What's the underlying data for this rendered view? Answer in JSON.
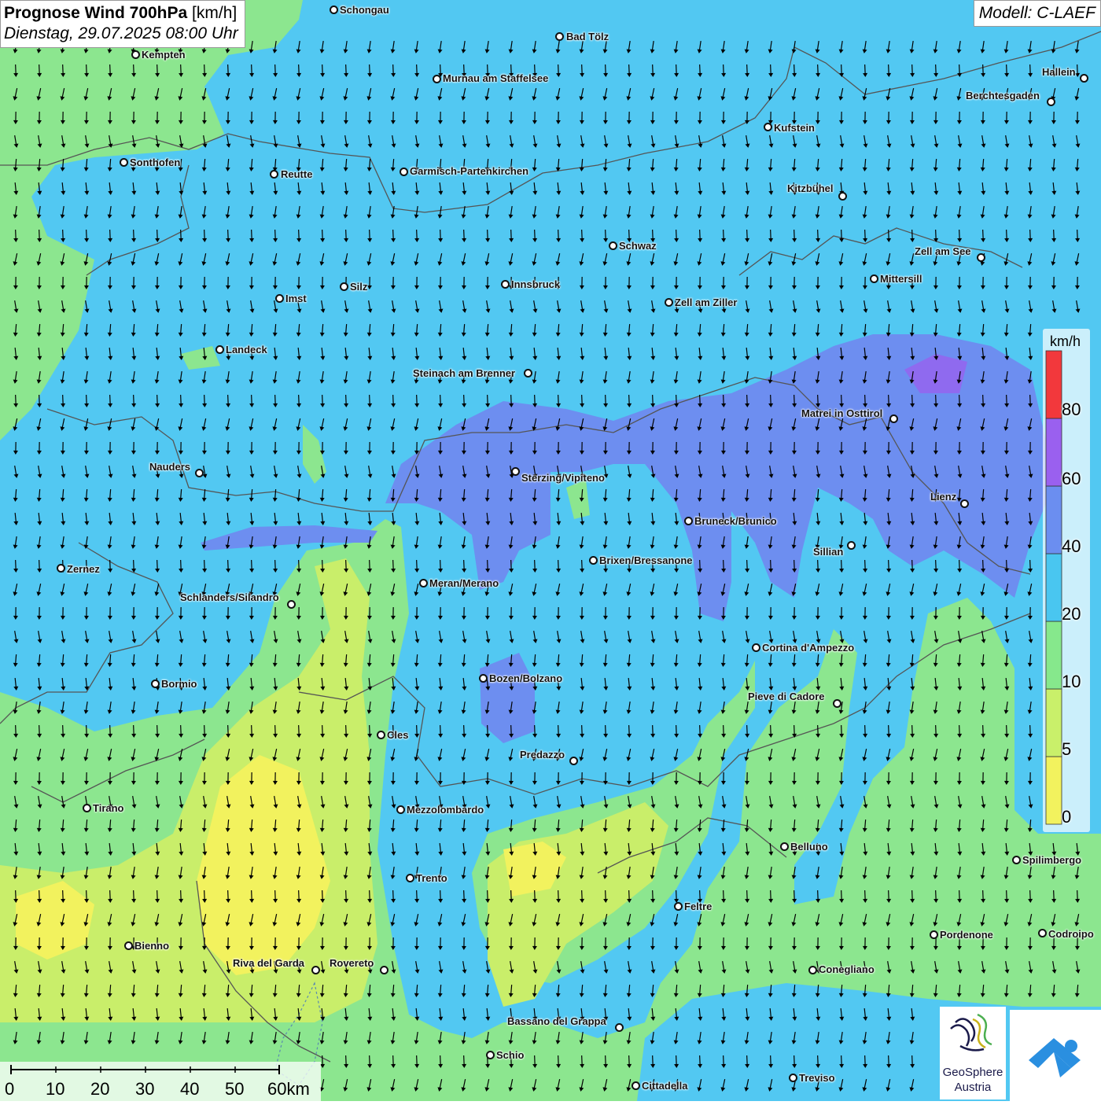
{
  "header": {
    "title_main": "Prognose Wind 700hPa",
    "title_unit": "[km/h]",
    "subtitle": "Dienstag, 29.07.2025 08:00 Uhr",
    "model": "Modell: C-LAEF"
  },
  "legend": {
    "unit": "km/h",
    "ticks": [
      "0",
      "5",
      "10",
      "20",
      "40",
      "60",
      "80"
    ],
    "colors": [
      "#f2f25e",
      "#c9f06a",
      "#86e88c",
      "#49c6f0",
      "#6b8ef0",
      "#9a60ef",
      "#f2383c"
    ]
  },
  "cities": [
    {
      "name": "Schongau"
    },
    {
      "name": "Bad Tölz"
    },
    {
      "name": "Kempten"
    },
    {
      "name": "Murnau am Staffelsee"
    },
    {
      "name": "Hallein"
    },
    {
      "name": "Berchtesgaden"
    },
    {
      "name": "Kufstein"
    },
    {
      "name": "Sonthofen"
    },
    {
      "name": "Reutte"
    },
    {
      "name": "Garmisch-Partenkirchen"
    },
    {
      "name": "Kitzbühel"
    },
    {
      "name": "Schwaz"
    },
    {
      "name": "Zell am See"
    },
    {
      "name": "Mittersill"
    },
    {
      "name": "Innsbruck"
    },
    {
      "name": "Silz"
    },
    {
      "name": "Imst"
    },
    {
      "name": "Zell am Ziller"
    },
    {
      "name": "Landeck"
    },
    {
      "name": "Steinach am Brenner"
    },
    {
      "name": "Matrei in Osttirol"
    },
    {
      "name": "Nauders"
    },
    {
      "name": "Sterzing/Vipiteno"
    },
    {
      "name": "Lienz"
    },
    {
      "name": "Bruneck/Brunico"
    },
    {
      "name": "Sillian"
    },
    {
      "name": "Brixen/Bressanone"
    },
    {
      "name": "Zernez"
    },
    {
      "name": "Meran/Merano"
    },
    {
      "name": "Schlanders/Silandro"
    },
    {
      "name": "Cortina d'Ampezzo"
    },
    {
      "name": "Bozen/Bolzano"
    },
    {
      "name": "Bormio"
    },
    {
      "name": "Pieve di Cadore"
    },
    {
      "name": "Cles"
    },
    {
      "name": "Predazzo"
    },
    {
      "name": "Tirano"
    },
    {
      "name": "Mezzolombardo"
    },
    {
      "name": "Belluno"
    },
    {
      "name": "Spilimbergo"
    },
    {
      "name": "Trento"
    },
    {
      "name": "Feltre"
    },
    {
      "name": "Pordenone"
    },
    {
      "name": "Codroipo"
    },
    {
      "name": "Bienno"
    },
    {
      "name": "Riva del Garda"
    },
    {
      "name": "Rovereto"
    },
    {
      "name": "Conegliano"
    },
    {
      "name": "Bassano del Grappa"
    },
    {
      "name": "Schio"
    },
    {
      "name": "Treviso"
    },
    {
      "name": "Cittadella"
    }
  ],
  "scalebar": {
    "labels": [
      "0",
      "10",
      "20",
      "30",
      "40",
      "50",
      "60km"
    ]
  },
  "logo": {
    "line1": "GeoSphere",
    "line2": "Austria"
  },
  "colors": {
    "wind_0_5": "#f2f25e",
    "wind_5_10": "#c9f06a",
    "wind_10_20": "#86e88c",
    "wind_20_40": "#49c6f0",
    "wind_40_60": "#6b8ef0",
    "wind_60_80": "#9a60ef",
    "wind_80_plus": "#f2383c",
    "logo_blue": "#2a8fe0"
  }
}
